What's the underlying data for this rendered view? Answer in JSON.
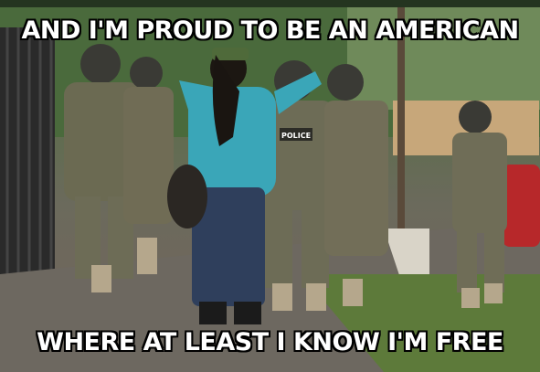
{
  "meme": {
    "top_text": "AND I'M PROUD TO BE AN AMERICAN",
    "bottom_text": "WHERE AT LEAST I KNOW I'M FREE"
  },
  "photo": {
    "badge_text": "POLICE"
  }
}
